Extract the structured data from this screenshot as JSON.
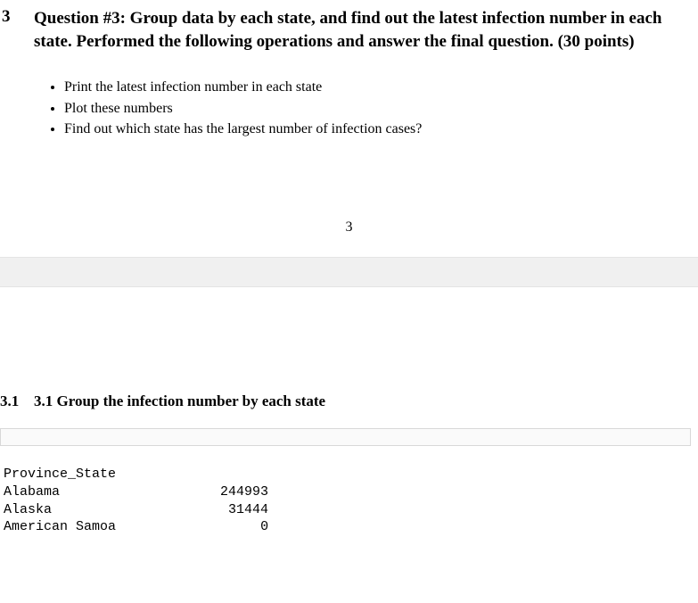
{
  "section": {
    "number": "3",
    "title": "Question #3: Group data by each state, and find out the latest infection number in each state. Performed the following operations and answer the final question. (30 points)"
  },
  "bullets": [
    "Print the latest infection number in each state",
    "Plot these numbers",
    "Find out which state has the largest number of infection cases?"
  ],
  "pageNumber": "3",
  "subsection": {
    "number": "3.1",
    "title": "3.1 Group the infection number by each state"
  },
  "output": {
    "header": "Province_State",
    "rows": [
      {
        "state": "Alabama",
        "value": "244993"
      },
      {
        "state": "Alaska",
        "value": " 31444"
      },
      {
        "state": "American Samoa",
        "value": "     0"
      }
    ]
  },
  "chart_data": {
    "type": "table",
    "title": "Province_State",
    "categories": [
      "Alabama",
      "Alaska",
      "American Samoa"
    ],
    "values": [
      244993,
      31444,
      0
    ]
  }
}
